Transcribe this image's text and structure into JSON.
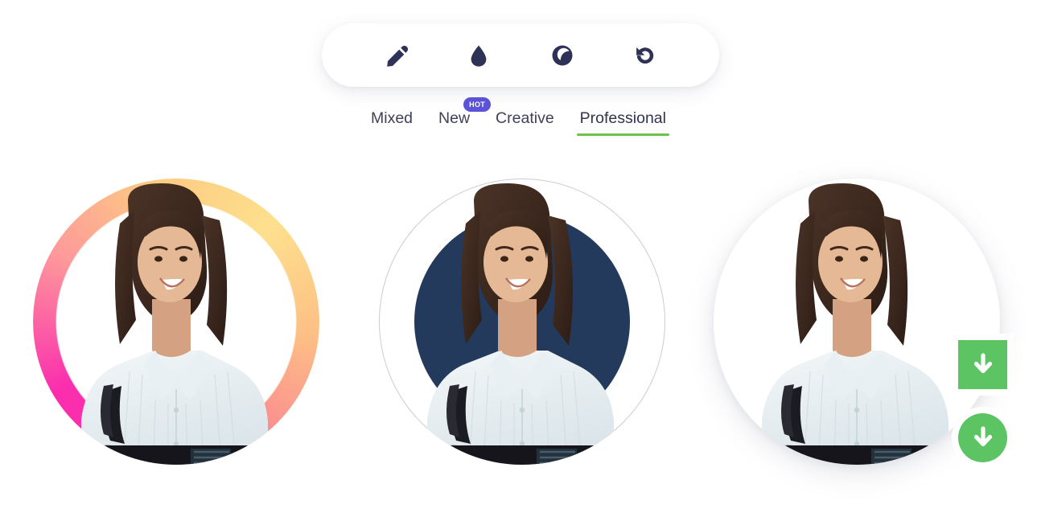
{
  "toolbar": {
    "name": "image-editor-toolbar",
    "tools": [
      {
        "id": "retouch",
        "icon": "pencil-icon",
        "label": "Retouch"
      },
      {
        "id": "blur",
        "icon": "droplet-icon",
        "label": "Blur"
      },
      {
        "id": "contrast",
        "icon": "moon-contrast-icon",
        "label": "Brightness"
      },
      {
        "id": "reset",
        "icon": "rotate-ccw-icon",
        "label": "Reset"
      }
    ]
  },
  "tabs": {
    "items": [
      {
        "label": "Mixed",
        "active": false,
        "badge": null
      },
      {
        "label": "New",
        "active": false,
        "badge": "HOT"
      },
      {
        "label": "Creative",
        "active": false,
        "badge": null
      },
      {
        "label": "Professional",
        "active": true,
        "badge": null
      }
    ],
    "active_indicator_color": "#6cc24a",
    "badge_color": "#5b52d8"
  },
  "results": {
    "cards": [
      {
        "id": "gradient-ring",
        "style_label": "Gradient Ring",
        "background_type": "gradient-ring",
        "colors": [
          "#fb2eae",
          "#fb8f8f",
          "#fdca82",
          "#fde08e"
        ]
      },
      {
        "id": "navy-circle",
        "style_label": "Navy Circle",
        "background_type": "outlined-circle-with-blob",
        "colors": [
          "#233a5c",
          "#c9ccd4"
        ]
      },
      {
        "id": "plain-white",
        "style_label": "Plain White",
        "background_type": "white-disc",
        "colors": [
          "#ffffff"
        ]
      }
    ]
  },
  "actions": {
    "download_square": {
      "label": "Download",
      "icon": "download-arrow-icon",
      "color": "#5dc463"
    },
    "download_circle": {
      "label": "Download",
      "icon": "download-arrow-icon",
      "color": "#5dc463"
    }
  }
}
